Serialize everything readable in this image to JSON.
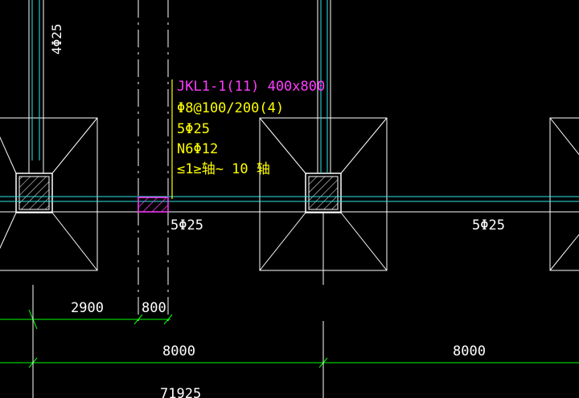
{
  "colors": {
    "background": "#000000",
    "white": "#ffffff",
    "cyan": "#2ee6e6",
    "yellow": "#ffff00",
    "magenta": "#ff3cff",
    "green": "#00ff00"
  },
  "column_rebar_label": "4Φ25",
  "beam_annotation": {
    "name": "JKL1-1(11) 400x800",
    "stirrup": "Φ8@100/200(4)",
    "top_rebar": "5Φ25",
    "side_rebar": "N6Φ12",
    "span_range": "≤1≥轴~ 10 轴"
  },
  "bottom_rebar_labels": [
    "5Φ25",
    "5Φ25"
  ],
  "dimensions": {
    "seg_2900": "2900",
    "seg_800": "800",
    "span_left": "8000",
    "span_right": "8000",
    "total": "71925"
  }
}
